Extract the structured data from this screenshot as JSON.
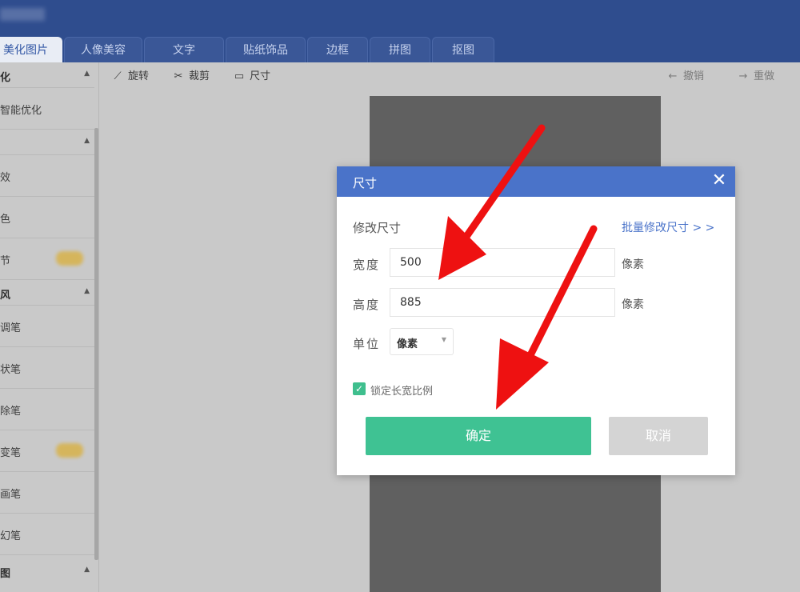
{
  "tabs": [
    {
      "label": "美化图片",
      "active": true
    },
    {
      "label": "人像美容",
      "active": false
    },
    {
      "label": "文字",
      "active": false
    },
    {
      "label": "贴纸饰品",
      "active": false
    },
    {
      "label": "边框",
      "active": false
    },
    {
      "label": "拼图",
      "active": false
    },
    {
      "label": "抠图",
      "active": false
    }
  ],
  "sidebar": {
    "items": [
      {
        "kind": "head",
        "label": "化"
      },
      {
        "kind": "item",
        "label": "智能优化"
      },
      {
        "kind": "head",
        "label": ""
      },
      {
        "kind": "item",
        "label": "效"
      },
      {
        "kind": "item",
        "label": "色"
      },
      {
        "kind": "item",
        "label": "节",
        "badge": true
      },
      {
        "kind": "head",
        "label": "风"
      },
      {
        "kind": "item",
        "label": "调笔"
      },
      {
        "kind": "item",
        "label": "状笔"
      },
      {
        "kind": "item",
        "label": "除笔"
      },
      {
        "kind": "item",
        "label": "变笔",
        "badge": true
      },
      {
        "kind": "item",
        "label": "画笔"
      },
      {
        "kind": "item",
        "label": "幻笔"
      },
      {
        "kind": "head",
        "label": "图"
      }
    ]
  },
  "toolbar": {
    "rotate_label": "旋转",
    "crop_label": "裁剪",
    "size_label": "尺寸",
    "undo_label": "撤销",
    "redo_label": "重做"
  },
  "dialog": {
    "title": "尺寸",
    "section_label": "修改尺寸",
    "batch_link": "批量修改尺寸 > >",
    "width_label": "宽度",
    "width_value": "500",
    "width_unit": "像素",
    "height_label": "高度",
    "height_value": "885",
    "height_unit": "像素",
    "unit_label": "单位",
    "unit_value": "像素",
    "lock_ratio_label": "锁定长宽比例",
    "lock_ratio_checked": true,
    "confirm_label": "确定",
    "cancel_label": "取消"
  },
  "colors": {
    "header_blue": "#2f4d8e",
    "dialog_blue": "#4a73c9",
    "confirm_green": "#3fc293",
    "arrow_red": "#ee1111"
  }
}
